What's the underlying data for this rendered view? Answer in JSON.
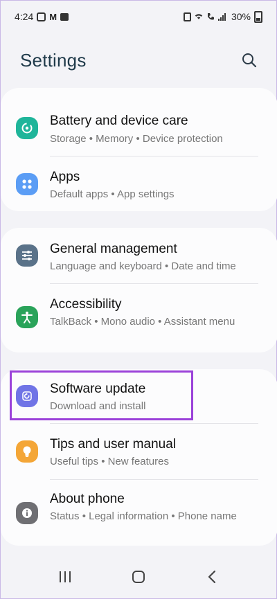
{
  "status_bar": {
    "time": "4:24",
    "battery": "30%"
  },
  "header": {
    "title": "Settings"
  },
  "colors": {
    "battery_icon": "#1fb59a",
    "apps_icon": "#5b9df5",
    "general_icon": "#5a7289",
    "accessibility_icon": "#2aa35a",
    "software_icon": "#7074e6",
    "tips_icon": "#f4a637",
    "about_icon": "#6f6f73",
    "highlight": "#9b42d9"
  },
  "items": {
    "battery": {
      "title": "Battery and device care",
      "sub": "Storage  •  Memory  •  Device protection"
    },
    "apps": {
      "title": "Apps",
      "sub": "Default apps  •  App settings"
    },
    "general": {
      "title": "General management",
      "sub": "Language and keyboard  •  Date and time"
    },
    "accessibility": {
      "title": "Accessibility",
      "sub": "TalkBack  •  Mono audio  •  Assistant menu"
    },
    "software": {
      "title": "Software update",
      "sub": "Download and install"
    },
    "tips": {
      "title": "Tips and user manual",
      "sub": "Useful tips  •  New features"
    },
    "about": {
      "title": "About phone",
      "sub": "Status  •  Legal information  •  Phone name"
    }
  }
}
